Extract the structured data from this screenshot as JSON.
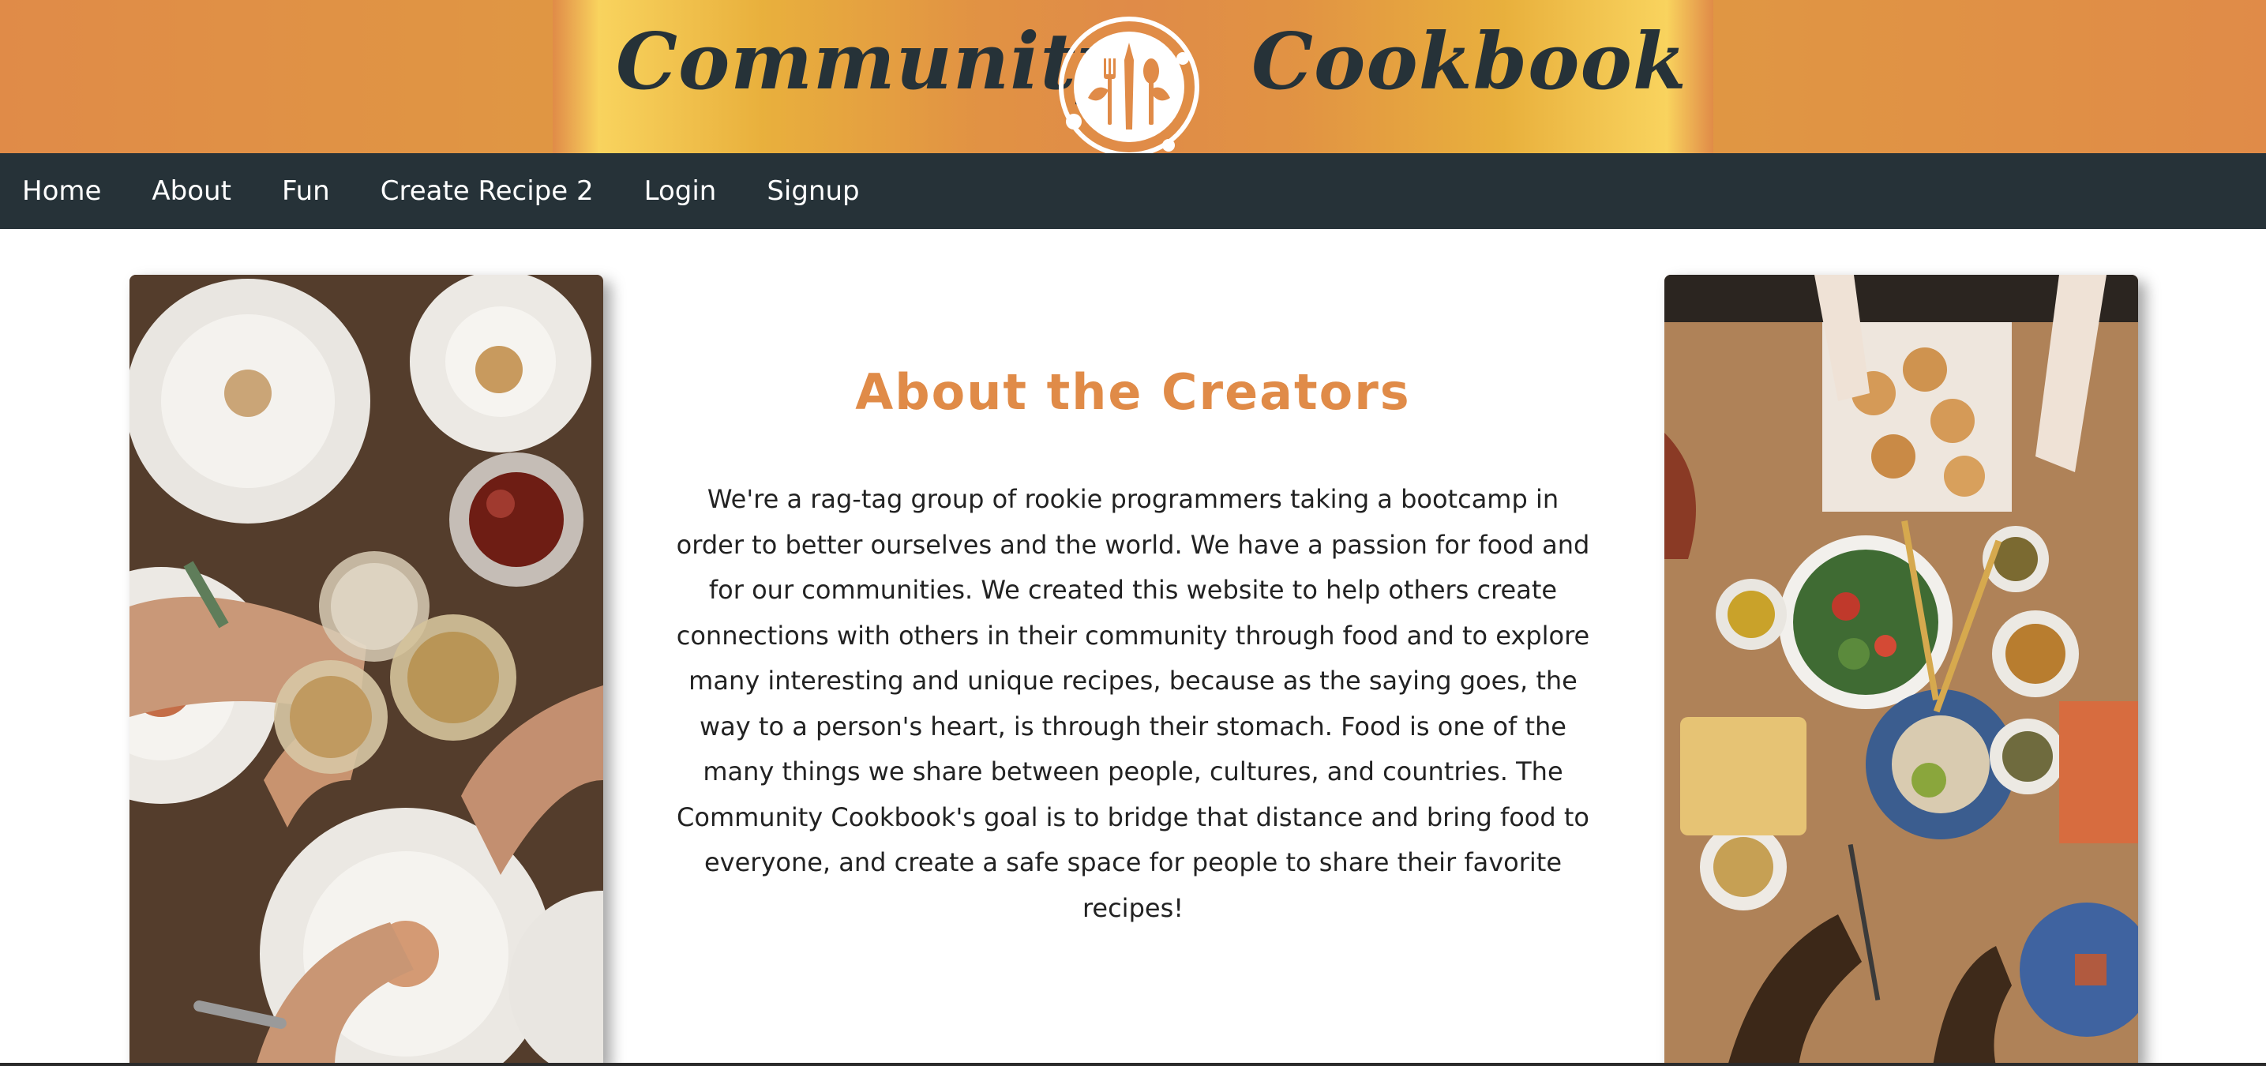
{
  "header": {
    "brand_left": "Community",
    "brand_right": "Cookbook",
    "logo_icon": "utensils-circle-logo-icon"
  },
  "nav": {
    "items": [
      {
        "label": "Home"
      },
      {
        "label": "About"
      },
      {
        "label": "Fun"
      },
      {
        "label": "Create Recipe 2"
      },
      {
        "label": "Login"
      },
      {
        "label": "Signup"
      }
    ]
  },
  "about": {
    "title": "About the Creators",
    "body": "We're a rag-tag group of rookie programmers taking a bootcamp in order to better ourselves and the world. We have a passion for food and for our communities. We created this website to help others create connections with others in their community through food and to explore many interesting and unique recipes, because as the saying goes, the way to a person's heart, is through their stomach. Food is one of the many things we share between people, cultures, and countries. The Community Cookbook's goal is to bridge that distance and bring food to everyone, and create a safe space for people to share their favorite recipes!"
  },
  "images": {
    "left": "toasting-drinks-dinner-photo",
    "right": "shared-table-feast-photo"
  },
  "colors": {
    "banner": "#e08b48",
    "banner_glow": "#f5c94e",
    "nav_bg": "#263238",
    "nav_text": "#ffffff",
    "title_accent": "#e08b48",
    "body_text": "#222222"
  }
}
